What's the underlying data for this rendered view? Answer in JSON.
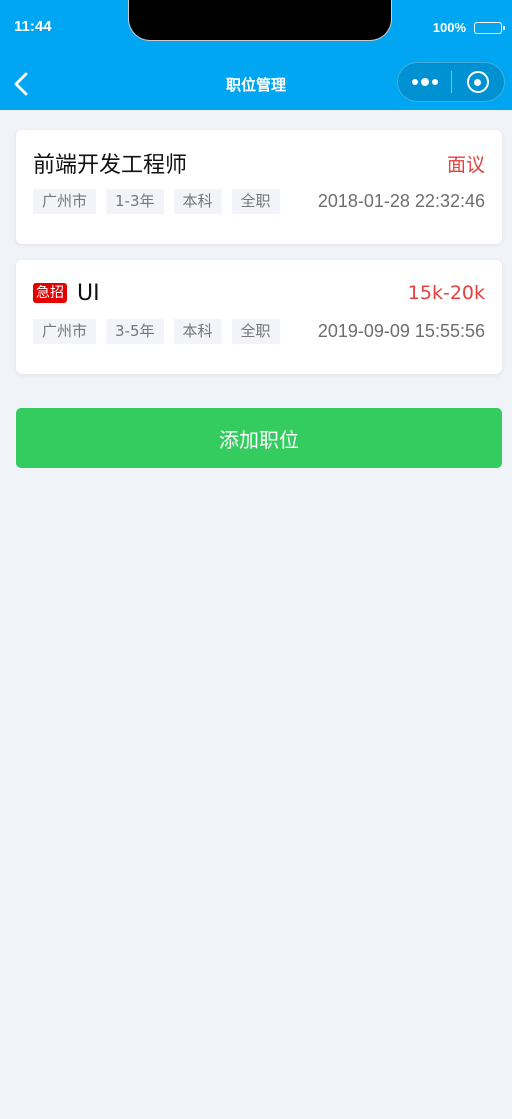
{
  "status_bar": {
    "time": "11:44",
    "battery": "100%",
    "battery_level": 1.0
  },
  "nav": {
    "title": "职位管理",
    "back_icon": "chevron-left-icon",
    "more_icon": "more-dots-icon",
    "close_icon": "target-circle-icon"
  },
  "jobs": [
    {
      "title": "前端开发工程师",
      "urgent": false,
      "salary": "面议",
      "tags": [
        "广州市",
        "1-3年",
        "本科",
        "全职"
      ],
      "time": "2018-01-28 22:32:46"
    },
    {
      "title": "UI",
      "urgent": true,
      "urgent_label": "急招",
      "salary": "15k-20k",
      "tags": [
        "广州市",
        "3-5年",
        "本科",
        "全职"
      ],
      "time": "2019-09-09 15:55:56"
    }
  ],
  "add_button_label": "添加职位",
  "colors": {
    "header": "#00a6f1",
    "salary": "#e64040",
    "urgent": "#e60000",
    "add_button": "#34cc5e",
    "background": "#f0f3f7"
  }
}
